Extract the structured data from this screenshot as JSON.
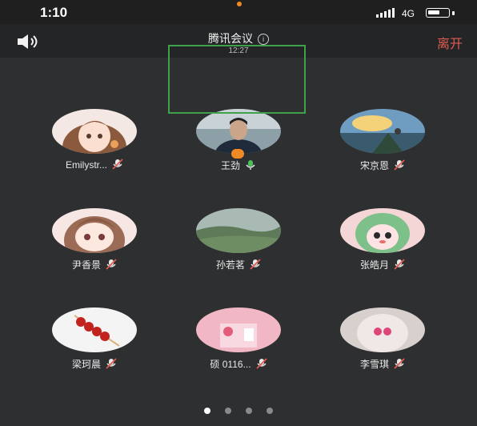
{
  "status_bar": {
    "time": "1:10",
    "network": "4G",
    "battery_level": 0.6
  },
  "header": {
    "title": "腾讯会议",
    "info_icon": "i",
    "duration": "12:27",
    "leave_label": "离开"
  },
  "participants": [
    {
      "name": "Emilystr...",
      "avatar": "anime-girl-portrait",
      "mic": "muted"
    },
    {
      "name": "王劲",
      "avatar": "man-portrait",
      "mic": "speaking",
      "host": true,
      "active": true
    },
    {
      "name": "宋京恩",
      "avatar": "painted-landscape",
      "mic": "muted"
    },
    {
      "name": "尹香景",
      "avatar": "anime-girl-bangs",
      "mic": "muted"
    },
    {
      "name": "孙若茗",
      "avatar": "green-hills",
      "mic": "muted"
    },
    {
      "name": "张皓月",
      "avatar": "cartoon-frog-hood",
      "mic": "muted"
    },
    {
      "name": "梁珂晨",
      "avatar": "candied-haws",
      "mic": "muted"
    },
    {
      "name": "硕 0116...",
      "avatar": "pink-toys",
      "mic": "muted"
    },
    {
      "name": "李雪琪",
      "avatar": "pink-fluffy",
      "mic": "muted"
    }
  ],
  "pager": {
    "pages": 4,
    "current": 1
  },
  "colors": {
    "background": "#2e2f31",
    "header": "#242527",
    "leave": "#e05a4f",
    "active_border": "#3fa24a",
    "host_badge": "#f08a24"
  }
}
